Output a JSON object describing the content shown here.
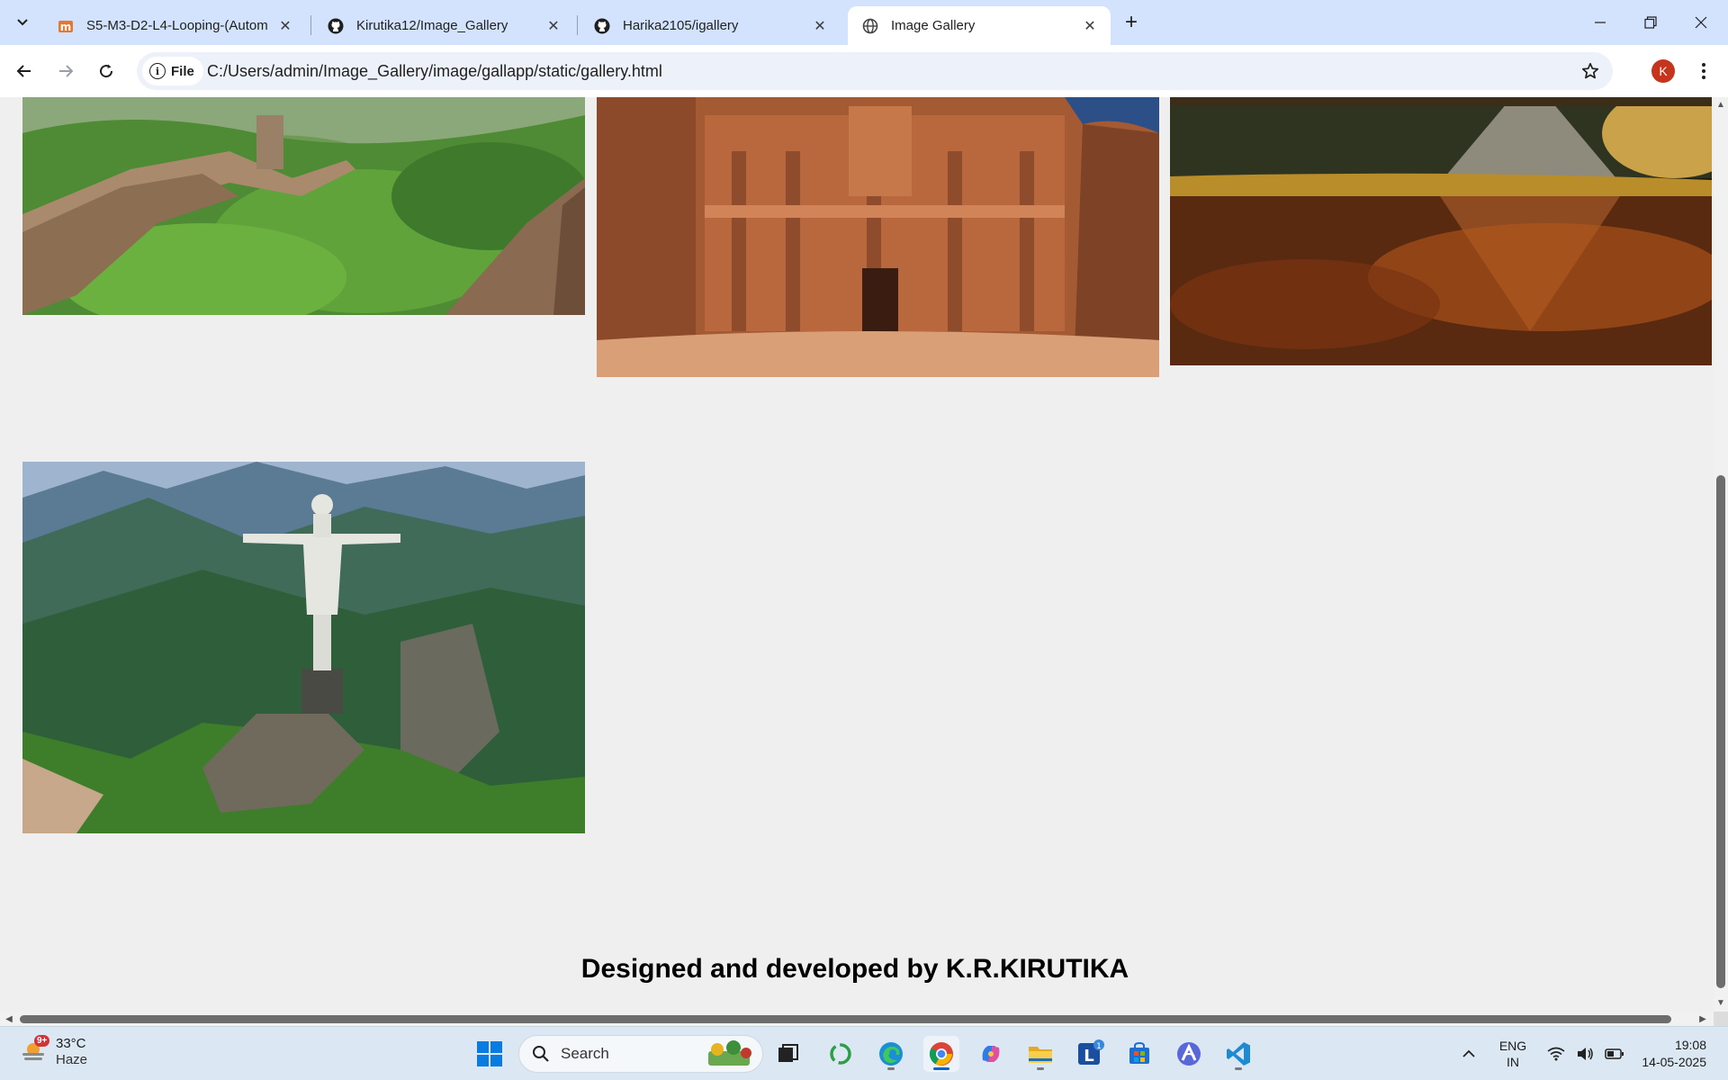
{
  "browser": {
    "tabs": [
      {
        "title": "S5-M3-D2-L4-Looping-(Autom",
        "icon": "m-brand-icon"
      },
      {
        "title": "Kirutika12/Image_Gallery",
        "icon": "github-icon"
      },
      {
        "title": "Harika2105/igallery",
        "icon": "github-icon"
      },
      {
        "title": "Image Gallery",
        "icon": "globe-icon",
        "active": true
      }
    ],
    "site_info_label": "File",
    "url": "C:/Users/admin/Image_Gallery/image/gallapp/static/gallery.html",
    "profile_initial": "K"
  },
  "page": {
    "images": [
      {
        "subject": "Great Wall of China"
      },
      {
        "subject": "Petra Al-Deir Monastery"
      },
      {
        "subject": "Chichen Itza pyramid reflection"
      },
      {
        "subject": "Christ the Redeemer"
      }
    ],
    "footer_text": "Designed and developed by K.R.KIRUTIKA"
  },
  "taskbar": {
    "weather_badge": "9+",
    "temperature": "33°C",
    "condition": "Haze",
    "search_label": "Search",
    "mail_badge": "1",
    "language_line1": "ENG",
    "language_line2": "IN",
    "time": "19:08",
    "date": "14-05-2025"
  },
  "colors": {
    "tabstrip": "#d3e3fd",
    "page_background": "#efefef",
    "taskbar": "#dbe7f3",
    "avatar": "#c5341d"
  }
}
